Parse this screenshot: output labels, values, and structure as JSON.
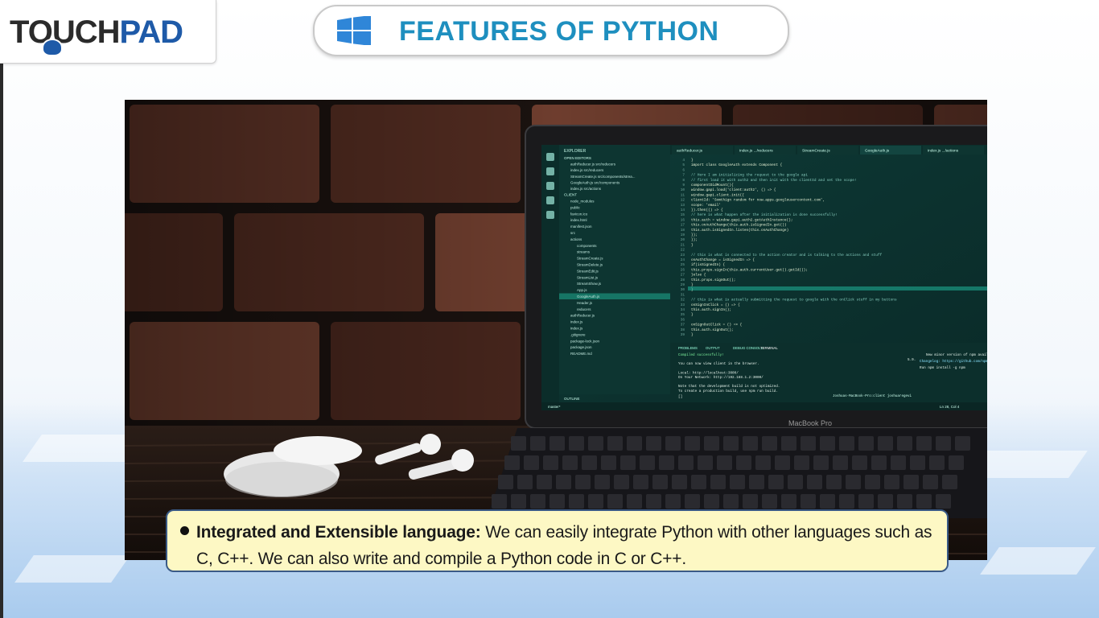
{
  "logo": {
    "part1": "TOUCH",
    "part2": "PAD"
  },
  "header": {
    "title": "FEATURES OF PYTHON",
    "icon": "windows-icon"
  },
  "photo": {
    "laptop_brand": "MacBook Pro",
    "editor": {
      "explorer_label": "EXPLORER",
      "open_editors_label": "OPEN EDITORS",
      "open_files": [
        "authReducer.js src/reducers",
        "index.js src/reducers",
        "StreamCreate.js src/components/strea...",
        "GoogleAuth.js src/components",
        "index.js src/actions"
      ],
      "project_label": "CLIENT",
      "tree": [
        "node_modules",
        "public",
        "favicon.ico",
        "index.html",
        "manifest.json",
        "src",
        "actions",
        "components",
        "streams",
        "StreamCreate.js",
        "StreamDelete.js",
        "StreamEdit.js",
        "StreamList.js",
        "StreamShow.js",
        "App.js",
        "GoogleAuth.js",
        "Header.js",
        "reducers",
        "authReducer.js",
        "index.js",
        "index.js",
        ".gitignore",
        "package-lock.json",
        "package.json",
        "README.md"
      ],
      "outline_label": "OUTLINE",
      "tabs": [
        "authReducer.js",
        "index.js .../reducers",
        "StreamCreate.js",
        "GoogleAuth.js",
        "index.js .../actions"
      ],
      "code_lines": [
        "}",
        "import class GoogleAuth extends Component {",
        "",
        "// Here I am initializing the request to the google api",
        "// first load it with auth2 and then init with the clientId and set the scope!",
        "  componentDidMount(){",
        "    window.gapi.load('client:auth2', () => {",
        "      window.gapi.client.init({",
        "        clientId: 'Somthign random for now.apps.googleusercontent.com',",
        "        scope: 'email'",
        "      }).then(() => {",
        "        // here is what happen after the initialization is done successfully!",
        "        this.auth = window.gapi.auth2.getAuthInstance();",
        "        this.onAuthChange(this.auth.isSignedIn.get())",
        "        this.auth.isSignedIn.listen(this.onAuthChange)",
        "      });",
        "    });",
        "  }",
        "",
        "// this is what is connected to the action creator and is talking to the actions and stuff",
        "  onAuthChange = isSignedIn => {",
        "    if(isSignedIn) {",
        "      this.props.signIn(this.auth.currentUser.get().getId());",
        "    }else {",
        "      this.props.signOut();",
        "    }",
        "  }",
        "",
        "// this is what is actually submitting the request to google with the onClick stuff in my buttons",
        "  onSignInClick = () => {",
        "    this.auth.signIn();",
        "  }",
        "",
        "  onSignOutClick = () => {",
        "    this.auth.signOut();",
        "  }"
      ],
      "line_numbers_start": 4,
      "panel_tabs": [
        "PROBLEMS",
        "OUTPUT",
        "DEBUG CONSOLE",
        "TERMINAL"
      ],
      "terminal_lines": [
        "Compiled successfully!",
        "",
        "You can now view client in the browser.",
        "",
        "  Local:            http://localhost:3000/",
        "  On Your Network:  http://192.168.1.2:3000/",
        "",
        "Note that the development build is not optimized.",
        "To create a production build, use npm run build."
      ],
      "terminal_prompt": "[]",
      "update_notice": [
        "New minor version of npm avail",
        "Changelog: https://github.com/npm/",
        "Run npm install -g npm"
      ],
      "update_version": "5.9.",
      "status_right": "Ln 28, Col 4",
      "status_left": "master*",
      "host": "Joshuas-MacBook-Pro:client joshuaregevi"
    }
  },
  "caption": {
    "term": "Integrated and Extensible language:",
    "text": " We can easily integrate Python with other languages such as C, C++. We can also write and compile a Python code in C or C++."
  },
  "colors": {
    "title": "#1e8fbf",
    "logo_blue": "#1e5aa8",
    "caption_bg": "#fdf8c4",
    "caption_border": "#3a5a86",
    "editor_bg": "#0f3a36",
    "accent_teal": "#1fb59a"
  }
}
